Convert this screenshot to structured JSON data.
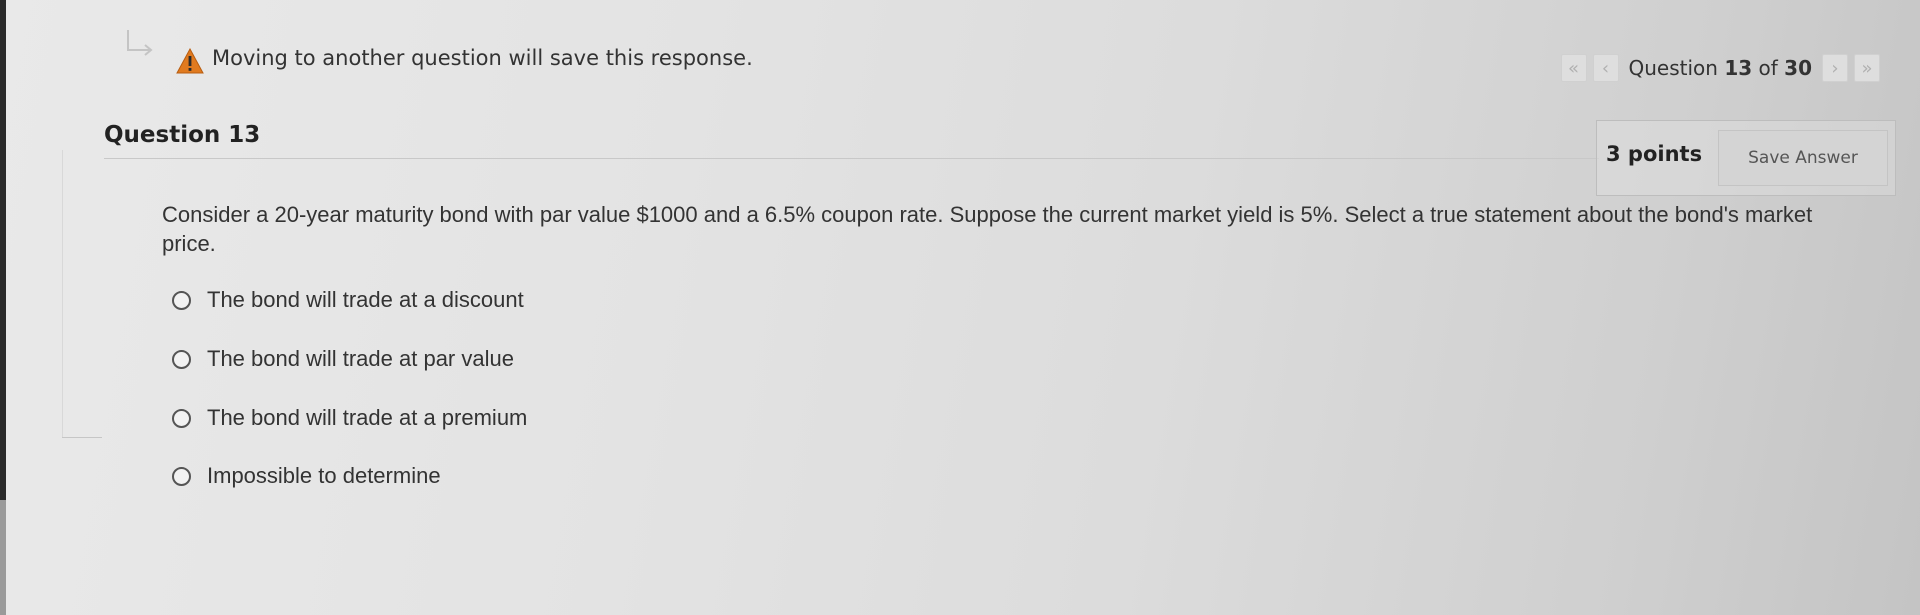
{
  "warning": {
    "text": "Moving to another question will save this response.",
    "icon": "warning-icon",
    "return_icon": "return-arrow-icon"
  },
  "navigation": {
    "first_icon": "double-chevron-left",
    "prev_icon": "chevron-left",
    "next_icon": "chevron-right",
    "last_icon": "double-chevron-right",
    "label_prefix": "Question",
    "current": "13",
    "label_of": "of",
    "total": "30"
  },
  "question": {
    "title": "Question 13",
    "points": "3 points",
    "save_label": "Save Answer",
    "text": "Consider a 20-year maturity bond with par value $1000 and a 6.5% coupon rate. Suppose the current market yield is 5%. Select a true statement about the bond's market price.",
    "options": [
      {
        "label": "The bond will trade at a discount"
      },
      {
        "label": "The bond will trade at par value"
      },
      {
        "label": "The bond will trade at a premium"
      },
      {
        "label": "Impossible to determine"
      }
    ]
  },
  "colors": {
    "warning_icon": "#e07a1f",
    "nav_disabled": "#b0b0b0"
  }
}
